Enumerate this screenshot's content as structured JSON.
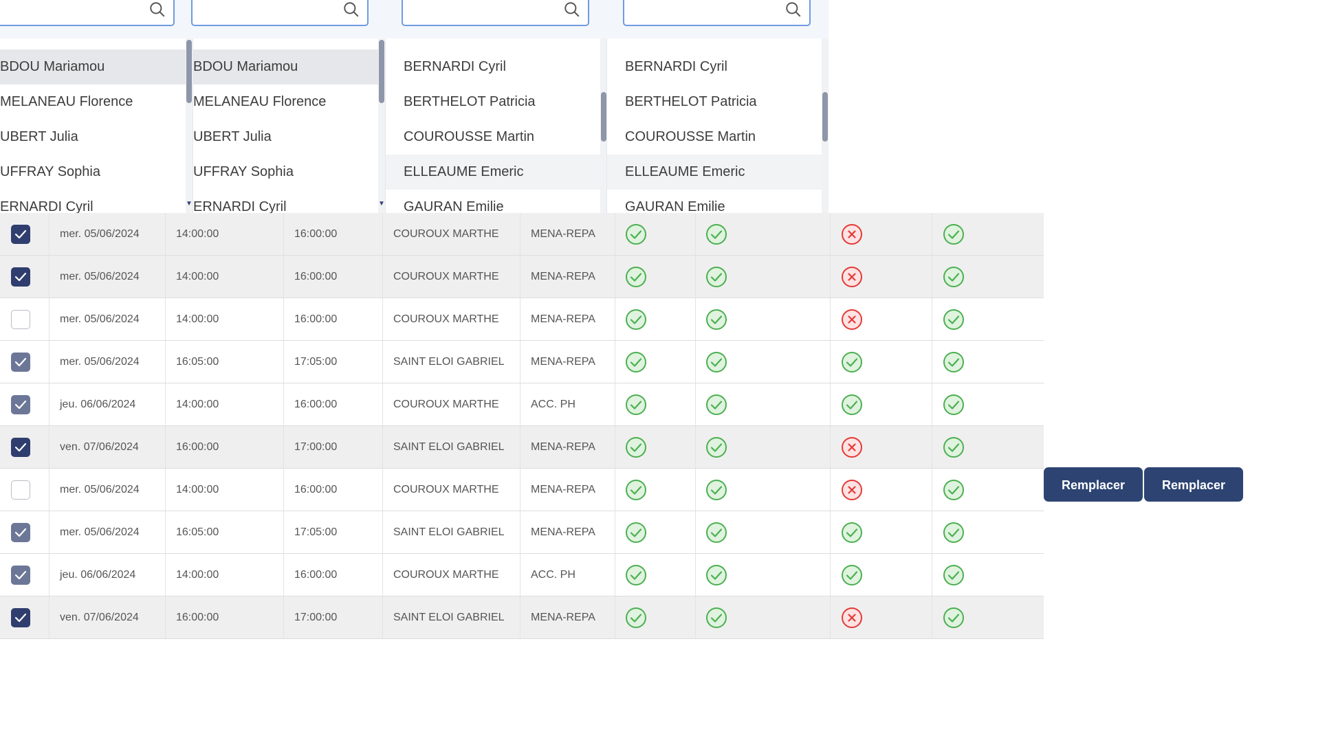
{
  "filters": {
    "lists": [
      {
        "items": [
          "BDOU Mariamou",
          "MELANEAU Florence",
          "UBERT Julia",
          "UFFRAY Sophia",
          "ERNARDI Cyril"
        ]
      },
      {
        "items": [
          "BDOU Mariamou",
          "MELANEAU Florence",
          "UBERT Julia",
          "UFFRAY Sophia",
          "ERNARDI Cyril"
        ]
      },
      {
        "items": [
          "BERNARDI Cyril",
          "BERTHELOT Patricia",
          "COUROUSSE Martin",
          "ELLEAUME Emeric",
          "GAURAN Emilie"
        ]
      },
      {
        "items": [
          "BERNARDI Cyril",
          "BERTHELOT Patricia",
          "COUROUSSE Martin",
          "ELLEAUME Emeric",
          "GAURAN Emilie"
        ]
      }
    ],
    "search_icon": "search-icon"
  },
  "rows": [
    {
      "checked": "dark",
      "date": "mer. 05/06/2024",
      "start": "14:00:00",
      "end": "16:00:00",
      "name": "COUROUX MARTHE",
      "type": "MENA-REPA",
      "s1": "ok",
      "s2": "ok",
      "s3": "ko",
      "s4": "ok"
    },
    {
      "checked": "dark",
      "date": "mer. 05/06/2024",
      "start": "14:00:00",
      "end": "16:00:00",
      "name": "COUROUX MARTHE",
      "type": "MENA-REPA",
      "s1": "ok",
      "s2": "ok",
      "s3": "ko",
      "s4": "ok"
    },
    {
      "checked": "off",
      "date": "mer. 05/06/2024",
      "start": "14:00:00",
      "end": "16:00:00",
      "name": "COUROUX MARTHE",
      "type": "MENA-REPA",
      "s1": "ok",
      "s2": "ok",
      "s3": "ko",
      "s4": "ok"
    },
    {
      "checked": "light",
      "date": "mer. 05/06/2024",
      "start": "16:05:00",
      "end": "17:05:00",
      "name": "SAINT ELOI GABRIEL",
      "type": "MENA-REPA",
      "s1": "ok",
      "s2": "ok",
      "s3": "ok",
      "s4": "ok"
    },
    {
      "checked": "light",
      "date": "jeu. 06/06/2024",
      "start": "14:00:00",
      "end": "16:00:00",
      "name": "COUROUX MARTHE",
      "type": "ACC. PH",
      "s1": "ok",
      "s2": "ok",
      "s3": "ok",
      "s4": "ok"
    },
    {
      "checked": "dark",
      "date": "ven. 07/06/2024",
      "start": "16:00:00",
      "end": "17:00:00",
      "name": "SAINT ELOI GABRIEL",
      "type": "MENA-REPA",
      "s1": "ok",
      "s2": "ok",
      "s3": "ko",
      "s4": "ok"
    },
    {
      "checked": "off",
      "date": "mer. 05/06/2024",
      "start": "14:00:00",
      "end": "16:00:00",
      "name": "COUROUX MARTHE",
      "type": "MENA-REPA",
      "s1": "ok",
      "s2": "ok",
      "s3": "ko",
      "s4": "ok"
    },
    {
      "checked": "light",
      "date": "mer. 05/06/2024",
      "start": "16:05:00",
      "end": "17:05:00",
      "name": "SAINT ELOI GABRIEL",
      "type": "MENA-REPA",
      "s1": "ok",
      "s2": "ok",
      "s3": "ok",
      "s4": "ok"
    },
    {
      "checked": "light",
      "date": "jeu. 06/06/2024",
      "start": "14:00:00",
      "end": "16:00:00",
      "name": "COUROUX MARTHE",
      "type": "ACC. PH",
      "s1": "ok",
      "s2": "ok",
      "s3": "ok",
      "s4": "ok"
    },
    {
      "checked": "dark",
      "date": "ven. 07/06/2024",
      "start": "16:00:00",
      "end": "17:00:00",
      "name": "SAINT ELOI GABRIEL",
      "type": "MENA-REPA",
      "s1": "ok",
      "s2": "ok",
      "s3": "ko",
      "s4": "ok"
    }
  ],
  "actions": {
    "replace_label_1": "Remplacer",
    "replace_label_2": "Remplacer"
  },
  "colors": {
    "ok": "#4caf50",
    "ok_fill": "#dff3df",
    "ko": "#e53935",
    "ko_fill": "#fde3e3",
    "checkbox_dark": "#2f3e6e",
    "checkbox_light": "#6c7798",
    "button": "#2d4473"
  }
}
